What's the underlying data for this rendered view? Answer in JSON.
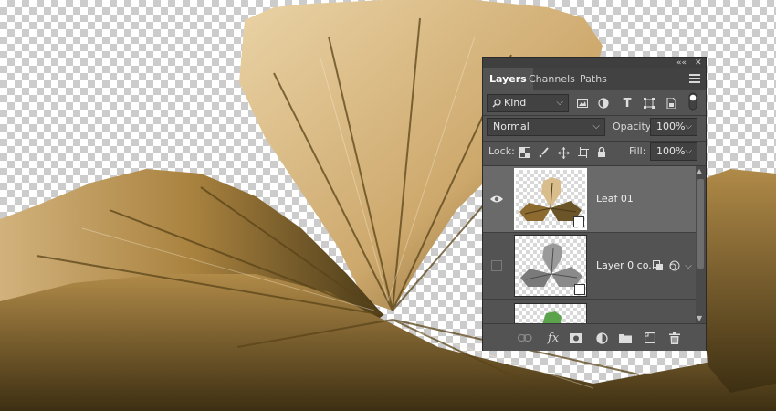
{
  "window": {
    "collapse_glyph": "««",
    "close_glyph": "✕"
  },
  "tabs": [
    {
      "label": "Layers",
      "active": true
    },
    {
      "label": "Channels",
      "active": false
    },
    {
      "label": "Paths",
      "active": false
    }
  ],
  "filter": {
    "kind_label": "Kind"
  },
  "blend": {
    "mode": "Normal",
    "opacity_label": "Opacity:",
    "opacity_value": "100%"
  },
  "lock": {
    "label": "Lock:",
    "fill_label": "Fill:",
    "fill_value": "100%"
  },
  "layers": [
    {
      "name": "Leaf 01",
      "visible": true,
      "selected": true,
      "thumb": "gold-leaf"
    },
    {
      "name": "Layer 0 co...",
      "visible": false,
      "selected": false,
      "thumb": "grey-leaf"
    },
    {
      "name": "",
      "visible": false,
      "selected": false,
      "thumb": "green-leaf"
    }
  ],
  "footer_icons": [
    "link-layers-icon",
    "fx-icon",
    "add-mask-icon",
    "adjustment-layer-icon",
    "group-folder-icon",
    "new-layer-icon",
    "trash-icon"
  ],
  "footer": {
    "fx_label": "fx"
  },
  "colors": {
    "panel_bg": "#535353",
    "panel_dark": "#424242",
    "selected_row": "#6a6a6a",
    "leaf_gold": "#d9bd8c",
    "leaf_dark": "#6b5428"
  }
}
